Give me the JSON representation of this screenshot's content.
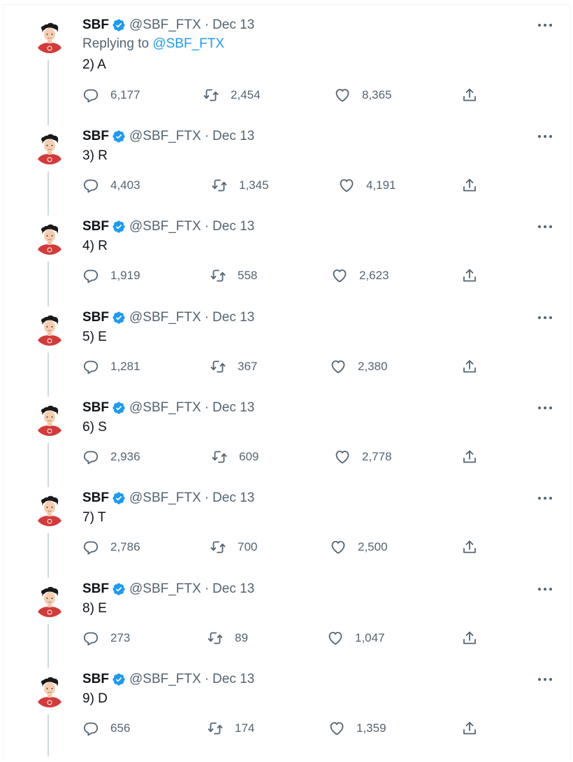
{
  "author": {
    "name": "SBF",
    "handle": "@SBF_FTX",
    "separator": "·",
    "date": "Dec 13"
  },
  "reply": {
    "prefix": "Replying to ",
    "mention": "@SBF_FTX"
  },
  "icons": {
    "reply": "reply-icon",
    "retweet": "retweet-icon",
    "like": "like-icon",
    "share": "share-icon",
    "more": "more-icon",
    "verified": "verified-badge-icon"
  },
  "colors": {
    "text": "#0f1419",
    "muted": "#536471",
    "link": "#1d9bf0",
    "verified": "#1d9bf0",
    "avatar_shirt": "#d33b3b"
  },
  "tweets": [
    {
      "text": "2) A",
      "replies": "6,177",
      "retweets": "2,454",
      "likes": "8,365",
      "show_reply_to": true
    },
    {
      "text": "3) R",
      "replies": "4,403",
      "retweets": "1,345",
      "likes": "4,191"
    },
    {
      "text": "4) R",
      "replies": "1,919",
      "retweets": "558",
      "likes": "2,623"
    },
    {
      "text": "5) E",
      "replies": "1,281",
      "retweets": "367",
      "likes": "2,380"
    },
    {
      "text": "6) S",
      "replies": "2,936",
      "retweets": "609",
      "likes": "2,778"
    },
    {
      "text": "7) T",
      "replies": "2,786",
      "retweets": "700",
      "likes": "2,500"
    },
    {
      "text": "8) E",
      "replies": "273",
      "retweets": "89",
      "likes": "1,047"
    },
    {
      "text": "9) D",
      "replies": "656",
      "retweets": "174",
      "likes": "1,359"
    }
  ]
}
